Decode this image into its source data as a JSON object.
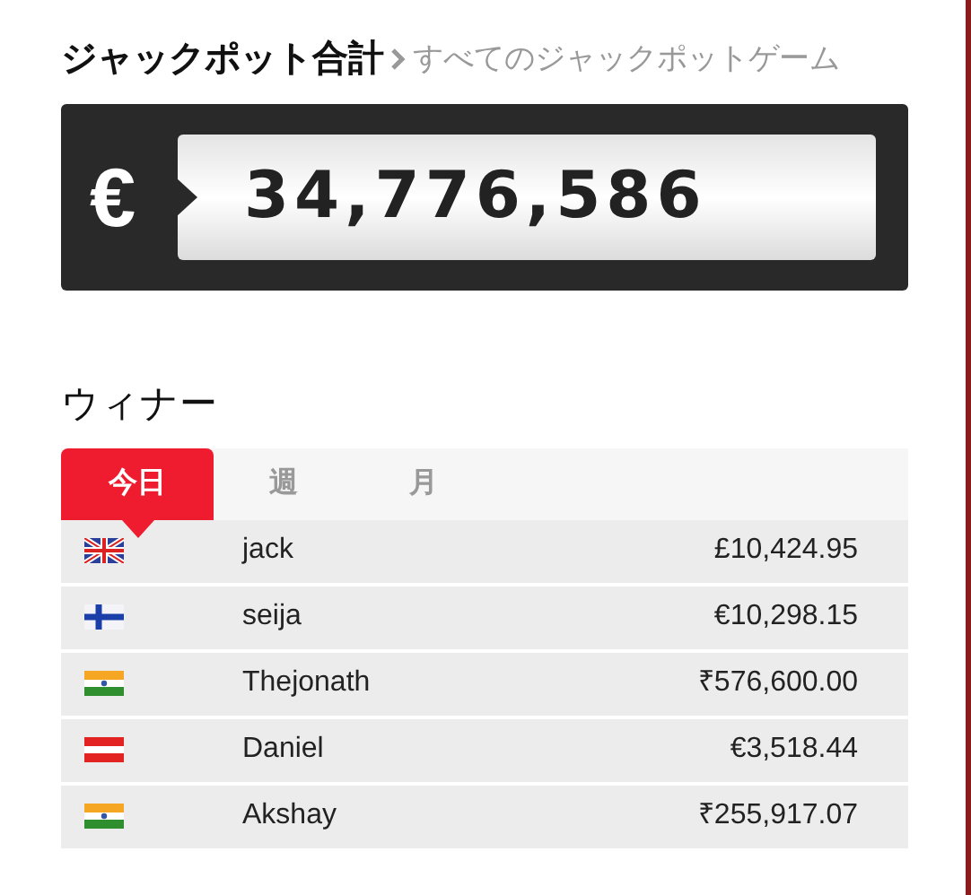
{
  "jackpot": {
    "title": "ジャックポット合計",
    "link": "すべてのジャックポットゲーム",
    "currency": "€",
    "amount": "34,776,586"
  },
  "winners": {
    "title": "ウィナー",
    "tabs": [
      {
        "label": "今日",
        "selected": true
      },
      {
        "label": "週",
        "selected": false
      },
      {
        "label": "月",
        "selected": false
      }
    ],
    "rows": [
      {
        "kind": "uk",
        "name": "jack",
        "amount": "£10,424.95"
      },
      {
        "kind": "finland",
        "name": "seija",
        "amount": "€10,298.15"
      },
      {
        "kind": "india",
        "name": "Thejonath",
        "amount": "₹576,600.00"
      },
      {
        "kind": "austria",
        "name": "Daniel",
        "amount": "€3,518.44"
      },
      {
        "kind": "india",
        "name": "Akshay",
        "amount": "₹255,917.07"
      }
    ]
  }
}
